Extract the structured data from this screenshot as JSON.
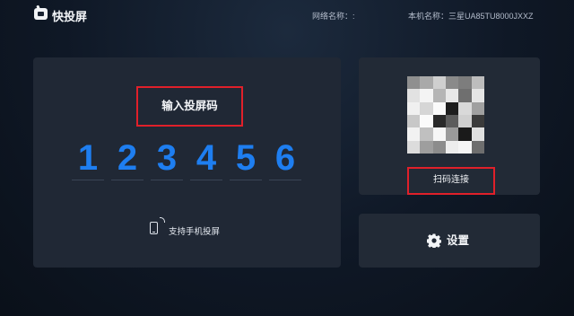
{
  "header": {
    "app_title": "快投屏",
    "network_label": "网络名称：:",
    "device_label": "本机名称：三星UA85TU8000JXXZ"
  },
  "code_panel": {
    "title": "输入投屏码",
    "digits": [
      "1",
      "2",
      "3",
      "4",
      "5",
      "6"
    ],
    "phone_cast_label": "支持手机投屏"
  },
  "qr_panel": {
    "scan_label": "扫码连接"
  },
  "settings_panel": {
    "label": "设置"
  },
  "colors": {
    "digit": "#1e7ef0",
    "highlight_frame": "#e0202a",
    "card_bg": "#222a36"
  },
  "icons": [
    "app-logo-icon",
    "phone-cast-icon",
    "gear-icon"
  ]
}
